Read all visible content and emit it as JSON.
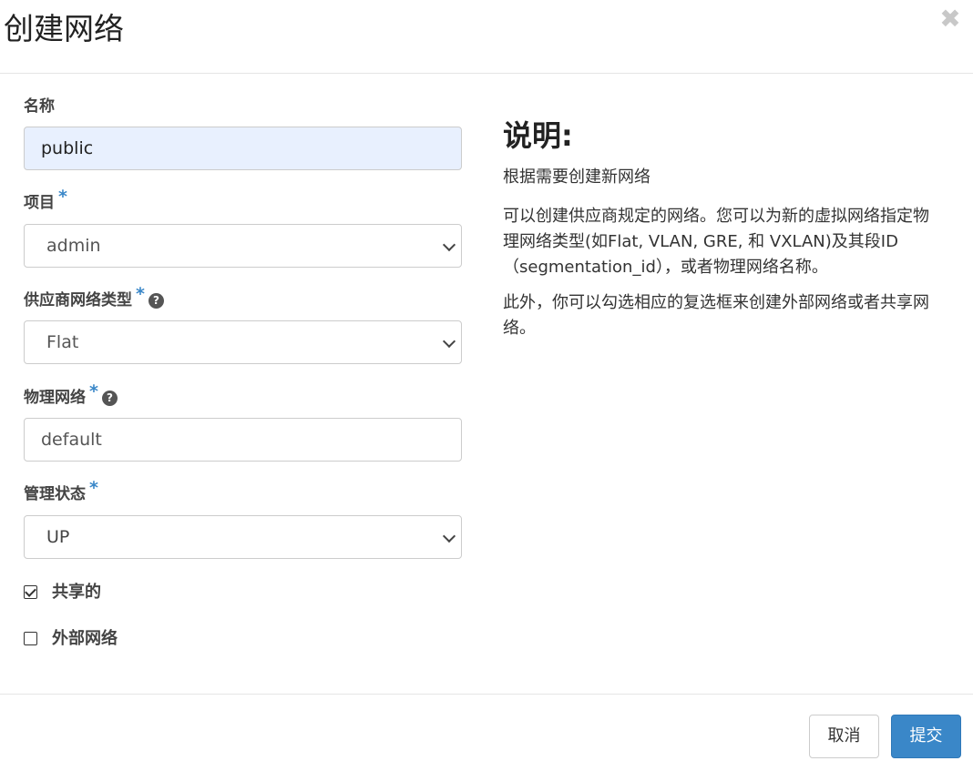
{
  "modal": {
    "title": "创建网络",
    "close_glyph": "✖"
  },
  "form": {
    "name": {
      "label": "名称",
      "value": "public"
    },
    "project": {
      "label": "项目",
      "required_mark": "*",
      "value": "admin"
    },
    "provider_network_type": {
      "label": "供应商网络类型",
      "required_mark": "*",
      "help_glyph": "?",
      "value": "Flat"
    },
    "physical_network": {
      "label": "物理网络",
      "required_mark": "*",
      "help_glyph": "?",
      "value": "default"
    },
    "admin_state": {
      "label": "管理状态",
      "required_mark": "*",
      "value": "UP"
    },
    "shared": {
      "label": "共享的",
      "checked": true
    },
    "external_network": {
      "label": "外部网络",
      "checked": false
    }
  },
  "description": {
    "title": "说明:",
    "paragraphs": [
      "根据需要创建新网络",
      "可以创建供应商规定的网络。您可以为新的虚拟网络指定物理网络类型(如Flat, VLAN, GRE, 和 VXLAN)及其段ID（segmentation_id），或者物理网络名称。",
      "此外，你可以勾选相应的复选框来创建外部网络或者共享网络。"
    ]
  },
  "footer": {
    "cancel_label": "取消",
    "submit_label": "提交"
  },
  "colors": {
    "accent": "#3a87c8",
    "autofill_bg": "#e8f0fe"
  }
}
